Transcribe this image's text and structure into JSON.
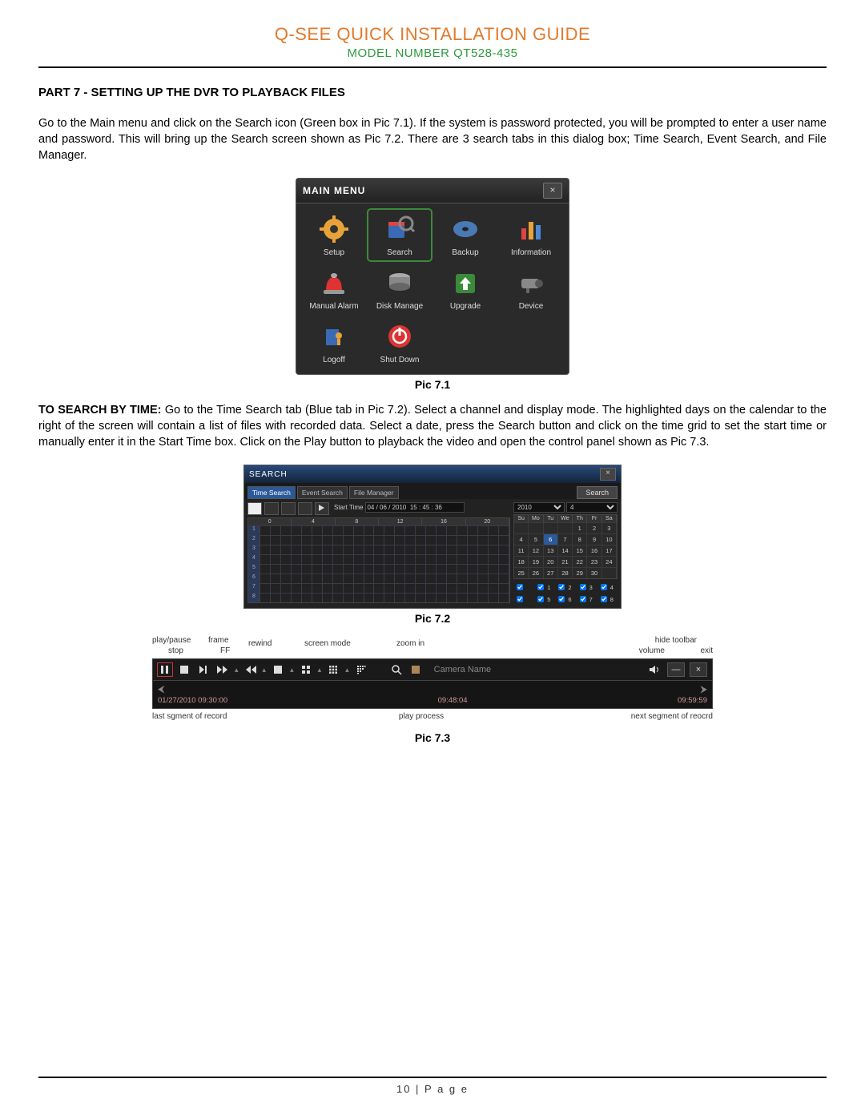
{
  "header": {
    "title": "Q-SEE QUICK INSTALLATION GUIDE",
    "model": "MODEL NUMBER QT528-435"
  },
  "section": {
    "heading": "PART 7 - SETTING UP THE DVR TO PLAYBACK FILES"
  },
  "para1": "Go to the Main menu and click on the Search icon (Green box in Pic 7.1). If the system is password protected, you will be prompted to enter a user name and password. This will bring up the Search screen shown as Pic 7.2. There are 3 search tabs in this dialog box; Time Search, Event Search, and File Manager.",
  "para2_bold": "TO SEARCH BY TIME:",
  "para2": " Go to the Time Search tab (Blue tab in Pic 7.2). Select a channel and display mode. The highlighted days on the calendar to the right of the screen will contain a list of files with recorded data. Select a date, press the Search button and click on the time grid to set the start time or manually enter it in the Start Time box. Click on the Play button to playback the video and open the control panel shown as Pic 7.3.",
  "captions": {
    "c1": "Pic 7.1",
    "c2": "Pic 7.2",
    "c3": "Pic 7.3"
  },
  "mainmenu": {
    "title": "MAIN MENU",
    "items": [
      "Setup",
      "Search",
      "Backup",
      "Information",
      "Manual Alarm",
      "Disk Manage",
      "Upgrade",
      "Device",
      "Logoff",
      "Shut Down"
    ]
  },
  "searchwin": {
    "title": "SEARCH",
    "tabs": [
      "Time Search",
      "Event Search",
      "File Manager"
    ],
    "searchbtn": "Search",
    "start_label": "Start Time",
    "start_value": "04 / 06 / 2010  15 : 45 : 36",
    "grid_hdr": [
      "0",
      "4",
      "8",
      "12",
      "16",
      "20"
    ],
    "rows": [
      "1",
      "2",
      "3",
      "4",
      "5",
      "6",
      "7",
      "8"
    ],
    "year": "2010",
    "month": "4",
    "days_hdr": [
      "Su",
      "Mo",
      "Tu",
      "We",
      "Th",
      "Fr",
      "Sa"
    ],
    "cal": [
      [
        "",
        "",
        "",
        "",
        "1",
        "2",
        "3"
      ],
      [
        "4",
        "5",
        "6",
        "7",
        "8",
        "9",
        "10"
      ],
      [
        "11",
        "12",
        "13",
        "14",
        "15",
        "16",
        "17"
      ],
      [
        "18",
        "19",
        "20",
        "21",
        "22",
        "23",
        "24"
      ],
      [
        "25",
        "26",
        "27",
        "28",
        "29",
        "30",
        ""
      ]
    ],
    "cb": [
      "",
      "1",
      "2",
      "3",
      "4",
      "",
      "5",
      "6",
      "7",
      "8"
    ]
  },
  "playback": {
    "top_labels": [
      "play/pause",
      "frame",
      "stop",
      "FF",
      "rewind",
      "screen mode",
      "zoom in",
      "hide toolbar",
      "volume",
      "exit"
    ],
    "camera": "Camera Name",
    "t1": "01/27/2010 09:30:00",
    "t2": "09:48:04",
    "t3": "09:59:59",
    "bot_labels": [
      "last sgment of record",
      "play process",
      "next segment of reocrd"
    ]
  },
  "footer": "10 | P a g e"
}
